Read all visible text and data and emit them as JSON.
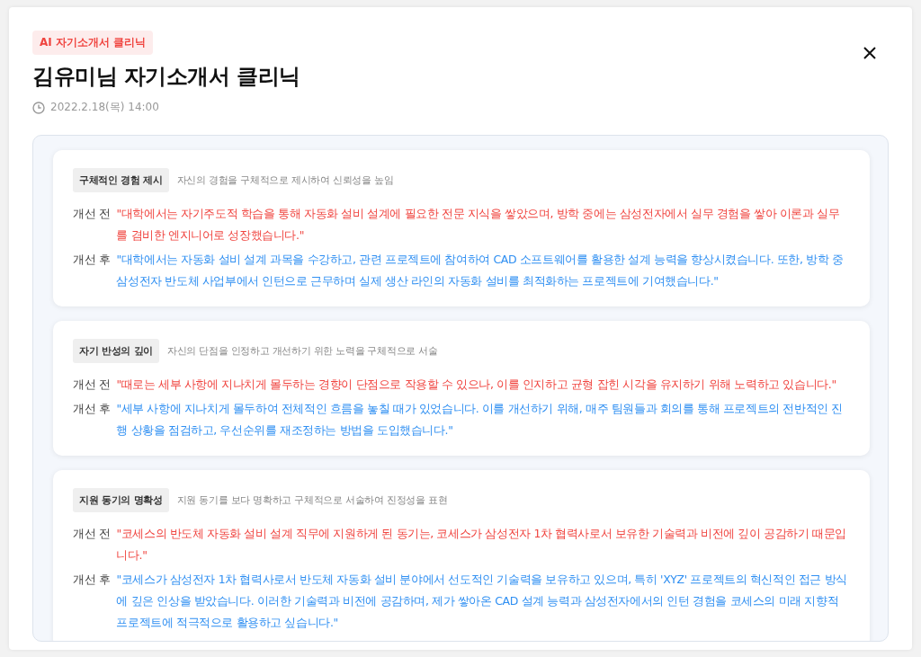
{
  "badge": "AI 자기소개서 클리닉",
  "title": "김유미님 자기소개서 클리닉",
  "datetime": "2022.2.18(목) 14:00",
  "sections": [
    {
      "tag": "구체적인 경험 제시",
      "description": "자신의 경험을 구체적으로 제시하여 신뢰성을 높임",
      "rows": [
        {
          "kind": "before",
          "label": "개선 전",
          "text": "\"대학에서는 자기주도적 학습을 통해 자동화 설비 설계에 필요한 전문 지식을 쌓았으며, 방학 중에는 삼성전자에서 실무 경험을 쌓아 이론과 실무를 겸비한 엔지니어로 성장했습니다.\""
        },
        {
          "kind": "after",
          "label": "개선 후",
          "text": "\"대학에서는 자동화 설비 설계 과목을 수강하고, 관련 프로젝트에 참여하여 CAD 소프트웨어를 활용한 설계 능력을 향상시켰습니다. 또한, 방학 중 삼성전자 반도체 사업부에서 인턴으로 근무하며 실제 생산 라인의 자동화 설비를 최적화하는 프로젝트에 기여했습니다.\""
        }
      ]
    },
    {
      "tag": "자기 반성의 깊이",
      "description": "자신의 단점을 인정하고 개선하기 위한 노력을 구체적으로 서술",
      "rows": [
        {
          "kind": "before",
          "label": "개선 전",
          "text": "\"때로는 세부 사항에 지나치게 몰두하는 경향이 단점으로 작용할 수 있으나, 이를 인지하고 균형 잡힌 시각을 유지하기 위해 노력하고 있습니다.\""
        },
        {
          "kind": "after",
          "label": "개선 후",
          "text": "\"세부 사항에 지나치게 몰두하여 전체적인 흐름을 놓칠 때가 있었습니다. 이를 개선하기 위해, 매주 팀원들과 회의를 통해 프로젝트의 전반적인 진행 상황을 점검하고, 우선순위를 재조정하는 방법을 도입했습니다.\""
        }
      ]
    },
    {
      "tag": "지원 동기의 명확성",
      "description": "지원 동기를 보다 명확하고 구체적으로 서술하여 진정성을 표현",
      "rows": [
        {
          "kind": "before",
          "label": "개선 전",
          "text": "\"코세스의 반도체 자동화 설비 설계 직무에 지원하게 된 동기는, 코세스가 삼성전자 1차 협력사로서 보유한 기술력과 비전에 깊이 공감하기 때문입니다.\""
        },
        {
          "kind": "after",
          "label": "개선 후",
          "text": "\"코세스가 삼성전자 1차 협력사로서 반도체 자동화 설비 분야에서 선도적인 기술력을 보유하고 있으며, 특히 'XYZ' 프로젝트의 혁신적인 접근 방식에 깊은 인상을 받았습니다. 이러한 기술력과 비전에 공감하며, 제가 쌓아온 CAD 설계 능력과 삼성전자에서의 인턴 경험을 코세스의 미래 지향적 프로젝트에 적극적으로 활용하고 싶습니다.\""
        }
      ]
    }
  ]
}
